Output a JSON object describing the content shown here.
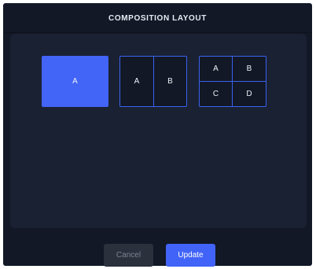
{
  "dialog": {
    "title": "COMPOSITION LAYOUT"
  },
  "layouts": [
    {
      "name": "single",
      "cells": [
        "A"
      ],
      "selected": true
    },
    {
      "name": "two-columns",
      "cells": [
        "A",
        "B"
      ],
      "selected": false
    },
    {
      "name": "grid-2x2",
      "cells": [
        "A",
        "B",
        "C",
        "D"
      ],
      "selected": false
    }
  ],
  "buttons": {
    "cancel_label": "Cancel",
    "update_label": "Update"
  },
  "colors": {
    "accent": "#4264f7",
    "background": "#121826",
    "panel": "#1a2133"
  }
}
